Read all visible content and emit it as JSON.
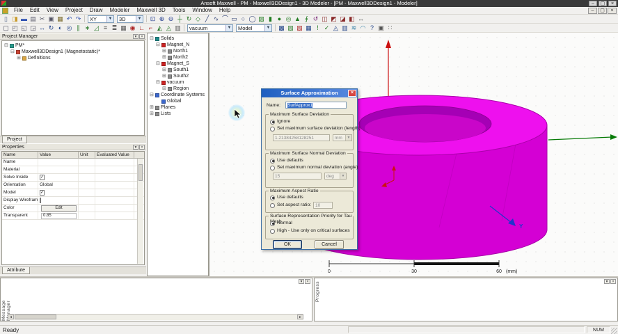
{
  "window": {
    "title": "Ansoft Maxwell - PM - Maxwell3DDesign1 - 3D Modeler - [PM - Maxwell3DDesign1 - Modeler]",
    "controls": {
      "minimize": "–",
      "maximize": "▢",
      "close": "×"
    },
    "status_ready": "Ready",
    "status_num": "NUM"
  },
  "menu": {
    "items": [
      "File",
      "Edit",
      "View",
      "Project",
      "Draw",
      "Modeler",
      "Maxwell 3D",
      "Tools",
      "Window",
      "Help"
    ]
  },
  "toolbar1": {
    "plane_select": "XY",
    "view_select": "3D",
    "left": [
      {
        "n": "new",
        "g": "▯",
        "c": "#556688"
      },
      {
        "n": "open",
        "g": "◨",
        "c": "#c89a2a"
      },
      {
        "n": "save",
        "g": "▬",
        "c": "#2a4db0"
      },
      {
        "n": "print",
        "g": "▤",
        "c": "#556"
      },
      {
        "n": "cut",
        "g": "✂",
        "c": "#556"
      },
      {
        "n": "copy",
        "g": "▣",
        "c": "#556"
      },
      {
        "n": "paste",
        "g": "▦",
        "c": "#7a6a2a"
      },
      {
        "n": "undo",
        "g": "↶",
        "c": "#2a4db0"
      },
      {
        "n": "redo",
        "g": "↷",
        "c": "#2a4db0"
      }
    ],
    "right": [
      {
        "n": "fit-all",
        "g": "⊡",
        "c": "#223b8f"
      },
      {
        "n": "zoom-in",
        "g": "⊕",
        "c": "#223b8f"
      },
      {
        "n": "zoom-out",
        "g": "⊖",
        "c": "#223b8f"
      },
      {
        "n": "pan",
        "g": "┼",
        "c": "#2a7a2a"
      },
      {
        "n": "rotate-view",
        "g": "↻",
        "c": "#2a7a2a"
      },
      {
        "n": "orient-view",
        "g": "◇",
        "c": "#2a7a2a"
      },
      {
        "n": "draw-line",
        "g": "╱",
        "c": "#334477"
      },
      {
        "n": "draw-spline",
        "g": "∿",
        "c": "#334477"
      },
      {
        "n": "draw-arc",
        "g": "⌒",
        "c": "#334477"
      },
      {
        "n": "draw-rectangle",
        "g": "▭",
        "c": "#334477"
      },
      {
        "n": "draw-ellipse",
        "g": "○",
        "c": "#334477"
      },
      {
        "n": "draw-circle",
        "g": "◯",
        "c": "#334477"
      },
      {
        "n": "draw-box",
        "g": "▧",
        "c": "#1f7a1f"
      },
      {
        "n": "draw-cylinder",
        "g": "▮",
        "c": "#1f7a1f"
      },
      {
        "n": "draw-sphere",
        "g": "●",
        "c": "#1f7a1f"
      },
      {
        "n": "draw-torus",
        "g": "◎",
        "c": "#1f7a1f"
      },
      {
        "n": "draw-cone",
        "g": "▲",
        "c": "#1f7a1f"
      },
      {
        "n": "draw-helix",
        "g": "∮",
        "c": "#1f7a1f"
      },
      {
        "n": "sweep",
        "g": "↺",
        "c": "#7a2a7a"
      },
      {
        "n": "unite",
        "g": "◫",
        "c": "#8a2a2a"
      },
      {
        "n": "subtract",
        "g": "◩",
        "c": "#8a2a2a"
      },
      {
        "n": "intersect",
        "g": "◪",
        "c": "#8a2a2a"
      },
      {
        "n": "section",
        "g": "◧",
        "c": "#8a2a2a"
      },
      {
        "n": "measure",
        "g": "↔",
        "c": "#555"
      }
    ]
  },
  "toolbar2": {
    "material_select": "vacuum",
    "model_select": "Model",
    "left": [
      {
        "n": "select-object",
        "g": "▢",
        "c": "#445"
      },
      {
        "n": "select-face",
        "g": "◰",
        "c": "#445"
      },
      {
        "n": "select-edge",
        "g": "◱",
        "c": "#445"
      },
      {
        "n": "select-vertex",
        "g": "◲",
        "c": "#445"
      },
      {
        "n": "move",
        "g": "↔",
        "c": "#224488"
      },
      {
        "n": "rotate-object",
        "g": "↻",
        "c": "#224488"
      },
      {
        "n": "mirror",
        "g": "◐",
        "c": "#224488"
      },
      {
        "n": "offset",
        "g": "◎",
        "c": "#224488"
      },
      {
        "n": "duplicate-line",
        "g": "∥",
        "c": "#2a7a2a"
      },
      {
        "n": "duplicate-around-axis",
        "g": "∗",
        "c": "#2a7a2a"
      },
      {
        "n": "scale",
        "g": "◿",
        "c": "#2a7a2a"
      },
      {
        "n": "align",
        "g": "≡",
        "c": "#555"
      },
      {
        "n": "history",
        "g": "≣",
        "c": "#555"
      },
      {
        "n": "grid-settings",
        "g": "▦",
        "c": "#555"
      },
      {
        "n": "snap-mode",
        "g": "◉",
        "c": "#aa2222"
      },
      {
        "n": "create-cs",
        "g": "∟",
        "c": "#aa2222"
      },
      {
        "n": "face-cs",
        "g": "⌐",
        "c": "#aa2222"
      },
      {
        "n": "boolean-split",
        "g": "◭",
        "c": "#2a7a2a"
      },
      {
        "n": "detach",
        "g": "◬",
        "c": "#2a7a2a"
      },
      {
        "n": "purge-history",
        "g": "▥",
        "c": "#555"
      }
    ],
    "right": [
      {
        "n": "assign-material",
        "g": "▩",
        "c": "#224488"
      },
      {
        "n": "assign-boundary",
        "g": "▨",
        "c": "#2a7a2a"
      },
      {
        "n": "assign-excitation",
        "g": "▧",
        "c": "#aa2222"
      },
      {
        "n": "mesh-operations",
        "g": "▦",
        "c": "#224488"
      },
      {
        "n": "analyze",
        "g": "!",
        "c": "#1f7a1f"
      },
      {
        "n": "validate",
        "g": "✓",
        "c": "#1f7a1f"
      },
      {
        "n": "optimetrics",
        "g": "◬",
        "c": "#224488"
      },
      {
        "n": "results",
        "g": "▥",
        "c": "#224488"
      },
      {
        "n": "fields-overlay",
        "g": "≋",
        "c": "#2a7aa2"
      },
      {
        "n": "radiation",
        "g": "◠",
        "c": "#2a7aa2"
      },
      {
        "n": "context-help",
        "g": "?",
        "c": "#224488"
      },
      {
        "n": "snapshot",
        "g": "▣",
        "c": "#555"
      },
      {
        "n": "options",
        "g": "∷",
        "c": "#555"
      }
    ]
  },
  "project_manager": {
    "title": "Project Manager",
    "tab": "Project",
    "tree": [
      {
        "label": "PM*",
        "level": 0,
        "exp": "-",
        "icon": "#2a9d8f"
      },
      {
        "label": "Maxwell3DDesign1 (Magnetostatic)*",
        "level": 1,
        "exp": "-",
        "icon": "#cc4433"
      },
      {
        "label": "Definitions",
        "level": 2,
        "exp": "+",
        "icon": "#d9a441"
      }
    ]
  },
  "properties": {
    "title": "Properties",
    "tab": "Attribute",
    "columns": [
      "Name",
      "Value",
      "Unit",
      "Evaluated Value"
    ],
    "rows": [
      {
        "name": "Name",
        "type": "text",
        "value": ""
      },
      {
        "name": "Material",
        "type": "text",
        "value": ""
      },
      {
        "name": "Solve Inside",
        "type": "checkbox",
        "value": "checked"
      },
      {
        "name": "Orientation",
        "type": "text",
        "value": "Global"
      },
      {
        "name": "Model",
        "type": "checkbox",
        "value": "checked"
      },
      {
        "name": "Display Wireframe",
        "type": "checkbox",
        "value": "unchecked"
      },
      {
        "name": "Color",
        "type": "button",
        "value": "Edit"
      },
      {
        "name": "Transparent",
        "type": "field",
        "value": "0.85"
      }
    ]
  },
  "model_tree": {
    "items": [
      {
        "label": "Solids",
        "level": 0,
        "exp": "-",
        "icon": "#1f8a8a"
      },
      {
        "label": "Magnet_N",
        "level": 1,
        "exp": "-",
        "icon": "#cc2222"
      },
      {
        "label": "North1",
        "level": 2,
        "exp": "+",
        "icon": "#8a8a8a"
      },
      {
        "label": "North2",
        "level": 2,
        "exp": "+",
        "icon": "#8a8a8a"
      },
      {
        "label": "Magnet_S",
        "level": 1,
        "exp": "-",
        "icon": "#cc2222"
      },
      {
        "label": "South1",
        "level": 2,
        "exp": "+",
        "icon": "#8a8a8a"
      },
      {
        "label": "South2",
        "level": 2,
        "exp": "+",
        "icon": "#8a8a8a"
      },
      {
        "label": "vacuum",
        "level": 1,
        "exp": "-",
        "icon": "#cc2222"
      },
      {
        "label": "Region",
        "level": 2,
        "exp": "+",
        "icon": "#8a8a8a"
      },
      {
        "label": "Coordinate Systems",
        "level": 0,
        "exp": "-",
        "icon": "#3a66cc"
      },
      {
        "label": "Global",
        "level": 1,
        "exp": "",
        "icon": "#3a66cc"
      },
      {
        "label": "Planes",
        "level": 0,
        "exp": "+",
        "icon": "#8a8a8a"
      },
      {
        "label": "Lists",
        "level": 0,
        "exp": "+",
        "icon": "#8a8a8a"
      }
    ]
  },
  "dialog": {
    "title": "Surface Approximation",
    "name_label": "Name:",
    "name_value": "SurfApprox1",
    "groups": {
      "deviation": {
        "label": "Maximum Surface Deviation",
        "opt_ignore": "Ignore",
        "opt_set": "Set maximum surface deviation (length)",
        "value": "1.21384258128251",
        "unit": "mm"
      },
      "normal": {
        "label": "Maximum Surface Normal Deviation",
        "opt_defaults": "Use defaults",
        "opt_set": "Set maximum normal deviation (angle)",
        "value": "15",
        "unit": "deg"
      },
      "aspect": {
        "label": "Maximum Aspect Ratio",
        "opt_defaults": "Use defaults",
        "opt_set": "Set aspect ratio:",
        "value": "10"
      },
      "priority": {
        "label": "Surface Representation Priority for Tau Mesh",
        "opt_normal": "Normal",
        "opt_high": "High - Use only on critical surfaces"
      }
    },
    "ok": "OK",
    "cancel": "Cancel"
  },
  "viewport": {
    "ruler": {
      "l0": "0",
      "l30": "30",
      "l60": "60",
      "unit": "(mm)"
    },
    "axis_y_label": "Y",
    "model_color": "#e300e3"
  },
  "panels": {
    "message_manager": "Message Manager",
    "progress": "Progress"
  }
}
